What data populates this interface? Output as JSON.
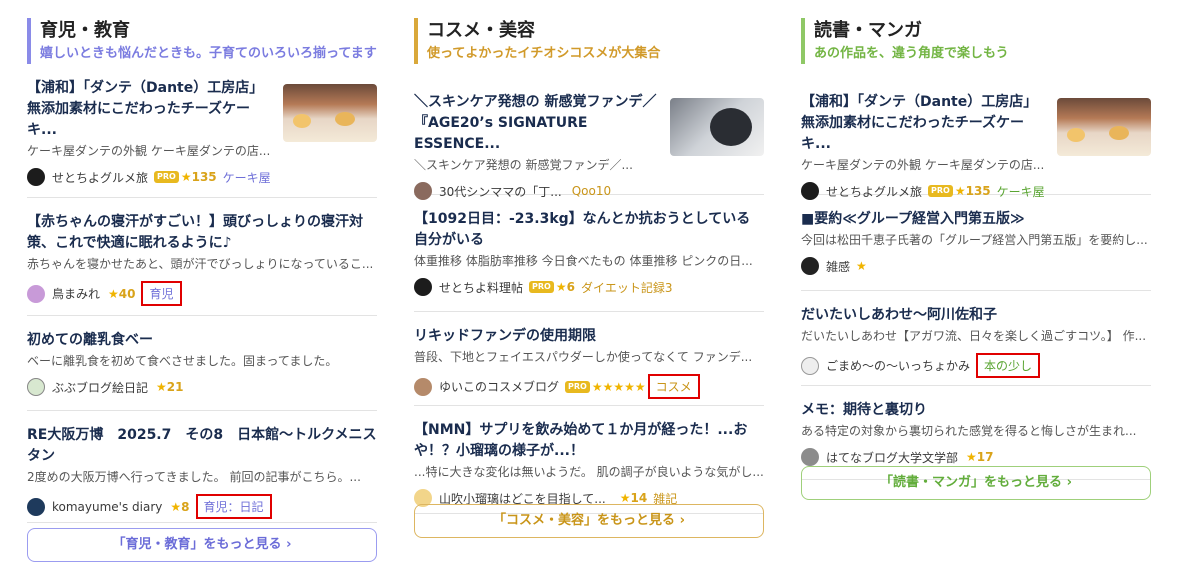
{
  "columns": [
    {
      "title": "育児・教育",
      "subtitle": "嬉しいときも悩んだときも。子育てのいろいろ揃ってます",
      "more_label": "「育児・教育」をもっと見る ›",
      "entries": [
        {
          "title": "【浦和】「ダンテ（Dante）工房店」無添加素材にこだわったチーズケーキ...",
          "excerpt": "ケーキ屋ダンテの外観 ケーキ屋ダンテの店...",
          "author": "せとちよグルメ旅",
          "pro": "PRO",
          "stars": "★",
          "count": "135",
          "tag": "ケーキ屋"
        },
        {
          "title": "【赤ちゃんの寝汗がすごい！】頭びっしょりの寝汗対策、これで快適に眠れるように♪",
          "excerpt": "赤ちゃんを寝かせたあと、頭が汗でびっしょりになっているこ...",
          "author": "鳥まみれ",
          "stars": "★",
          "count": "40",
          "tag": "育児"
        },
        {
          "title": "初めての離乳食ベー",
          "excerpt": "ベーに離乳食を初めて食べさせました。固まってました。",
          "author": "ぶぶブログ絵日記",
          "stars": "★",
          "count": "21"
        },
        {
          "title": "RE大阪万博　2025.7　その8　日本館〜トルクメニスタン",
          "excerpt": "2度めの大阪万博へ行ってきました。 前回の記事がこちら。...",
          "author": "komayume's diary",
          "stars": "★",
          "count": "8",
          "tag": "育児：日記"
        }
      ]
    },
    {
      "title": "コスメ・美容",
      "subtitle": "使ってよかったイチオシコスメが大集合",
      "more_label": "「コスメ・美容」をもっと見る ›",
      "entries": [
        {
          "title": "＼スキンケア発想の 新感覚ファンデ／『AGE20’s SIGNATURE ESSENCE...",
          "excerpt": "＼スキンケア発想の 新感覚ファンデ／...",
          "author": "30代シンママの「丁...",
          "extra": "Qoo10"
        },
        {
          "title": "【1092日目：-23.3kg】なんとか抗おうとしている自分がいる",
          "excerpt": "体重推移 体脂肪率推移 今日食べたもの 体重推移 ピンクの日...",
          "author": "せとちよ料理帖",
          "pro": "PRO",
          "stars": "★",
          "count": "6",
          "tag": "ダイエット記録3"
        },
        {
          "title": "リキッドファンデの使用期限",
          "excerpt": "普段、下地とフェイエスパウダーしか使ってなくて ファンデ...",
          "author": "ゆいこのコスメブログ",
          "pro": "PRO",
          "stars": "★★★★★",
          "tag": "コスメ"
        },
        {
          "title": "【NMN】サプリを飲み始めて１か月が経った！...おや！？小瑠璃の様子が...！",
          "excerpt": "...特に大きな変化は無いようだ。 肌の調子が良いような気がし...",
          "author": "山吹小瑠璃はどこを目指して...",
          "stars": "★",
          "count": "14",
          "tag": "雑記"
        }
      ]
    },
    {
      "title": "読書・マンガ",
      "subtitle": "あの作品を、違う角度で楽しもう",
      "more_label": "「読書・マンガ」をもっと見る ›",
      "entries": [
        {
          "title": "【浦和】「ダンテ（Dante）工房店」無添加素材にこだわったチーズケーキ...",
          "excerpt": "ケーキ屋ダンテの外観 ケーキ屋ダンテの店...",
          "author": "せとちよグルメ旅",
          "pro": "PRO",
          "stars": "★",
          "count": "135",
          "tag": "ケーキ屋"
        },
        {
          "title": "■要約≪グループ経営入門第五版≫",
          "excerpt": "今回は松田千恵子氏著の「グループ経営入門第五版」を要約し...",
          "author": "雑感",
          "stars": "★"
        },
        {
          "title": "だいたいしあわせ〜阿川佐和子",
          "excerpt": "だいたいしあわせ【アガワ流、日々を楽しく過ごすコツ。】 作...",
          "author": "ごまめ〜の〜いっちょかみ",
          "tag": "本の少し"
        },
        {
          "title": "メモ：期待と裏切り",
          "excerpt": "ある特定の対象から裏切られた感覚を得ると悔しさが生まれ...",
          "author": "はてなブログ大学文学部",
          "stars": "★",
          "count": "17"
        }
      ]
    }
  ],
  "colors": {
    "kids_accent": "#8a8be8",
    "cosme_accent": "#d9a83a",
    "books_accent": "#8fc866",
    "star": "#f0b400",
    "highlight_box": "#e00000"
  }
}
